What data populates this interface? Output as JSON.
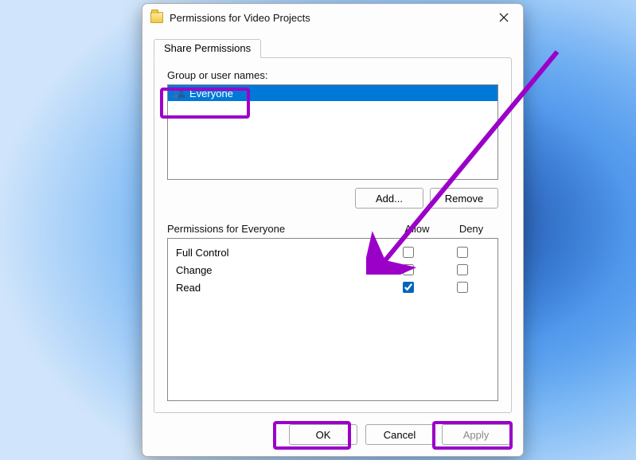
{
  "dialog": {
    "title": "Permissions for Video Projects"
  },
  "tab": {
    "label": "Share Permissions"
  },
  "group_label": "Group or user names:",
  "users": [
    {
      "name": "Everyone"
    }
  ],
  "buttons": {
    "add": "Add...",
    "remove": "Remove",
    "ok": "OK",
    "cancel": "Cancel",
    "apply": "Apply"
  },
  "perm_label": "Permissions for Everyone",
  "columns": {
    "allow": "Allow",
    "deny": "Deny"
  },
  "permissions": [
    {
      "name": "Full Control",
      "allow": false,
      "deny": false
    },
    {
      "name": "Change",
      "allow": false,
      "deny": false
    },
    {
      "name": "Read",
      "allow": true,
      "deny": false
    }
  ],
  "annotations": {
    "color": "#9b00c8"
  }
}
